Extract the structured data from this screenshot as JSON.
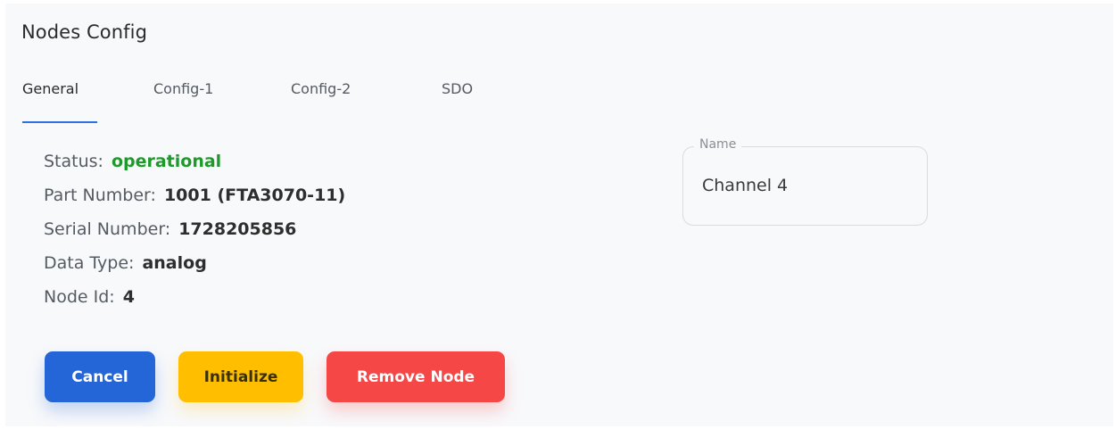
{
  "panel": {
    "title": "Nodes Config"
  },
  "tabs": {
    "active": "General",
    "items": [
      {
        "label": "General"
      },
      {
        "label": "Config-1"
      },
      {
        "label": "Config-2"
      },
      {
        "label": "SDO"
      }
    ]
  },
  "info": {
    "status": {
      "label": "Status:",
      "value": "operational",
      "color": "#1e9a2a"
    },
    "part_number": {
      "label": "Part Number:",
      "value": "1001 (FTA3070-11)"
    },
    "serial_number": {
      "label": "Serial Number:",
      "value": "1728205856"
    },
    "data_type": {
      "label": "Data Type:",
      "value": "analog"
    },
    "node_id": {
      "label": "Node Id:",
      "value": "4"
    }
  },
  "name_field": {
    "legend": "Name",
    "value": "Channel 4"
  },
  "actions": {
    "cancel_label": "Cancel",
    "initialize_label": "Initialize",
    "remove_label": "Remove Node"
  },
  "colors": {
    "primary": "#2465d7",
    "warning": "#ffbf00",
    "danger": "#f64747",
    "tab_indicator": "#2f6fe0"
  }
}
